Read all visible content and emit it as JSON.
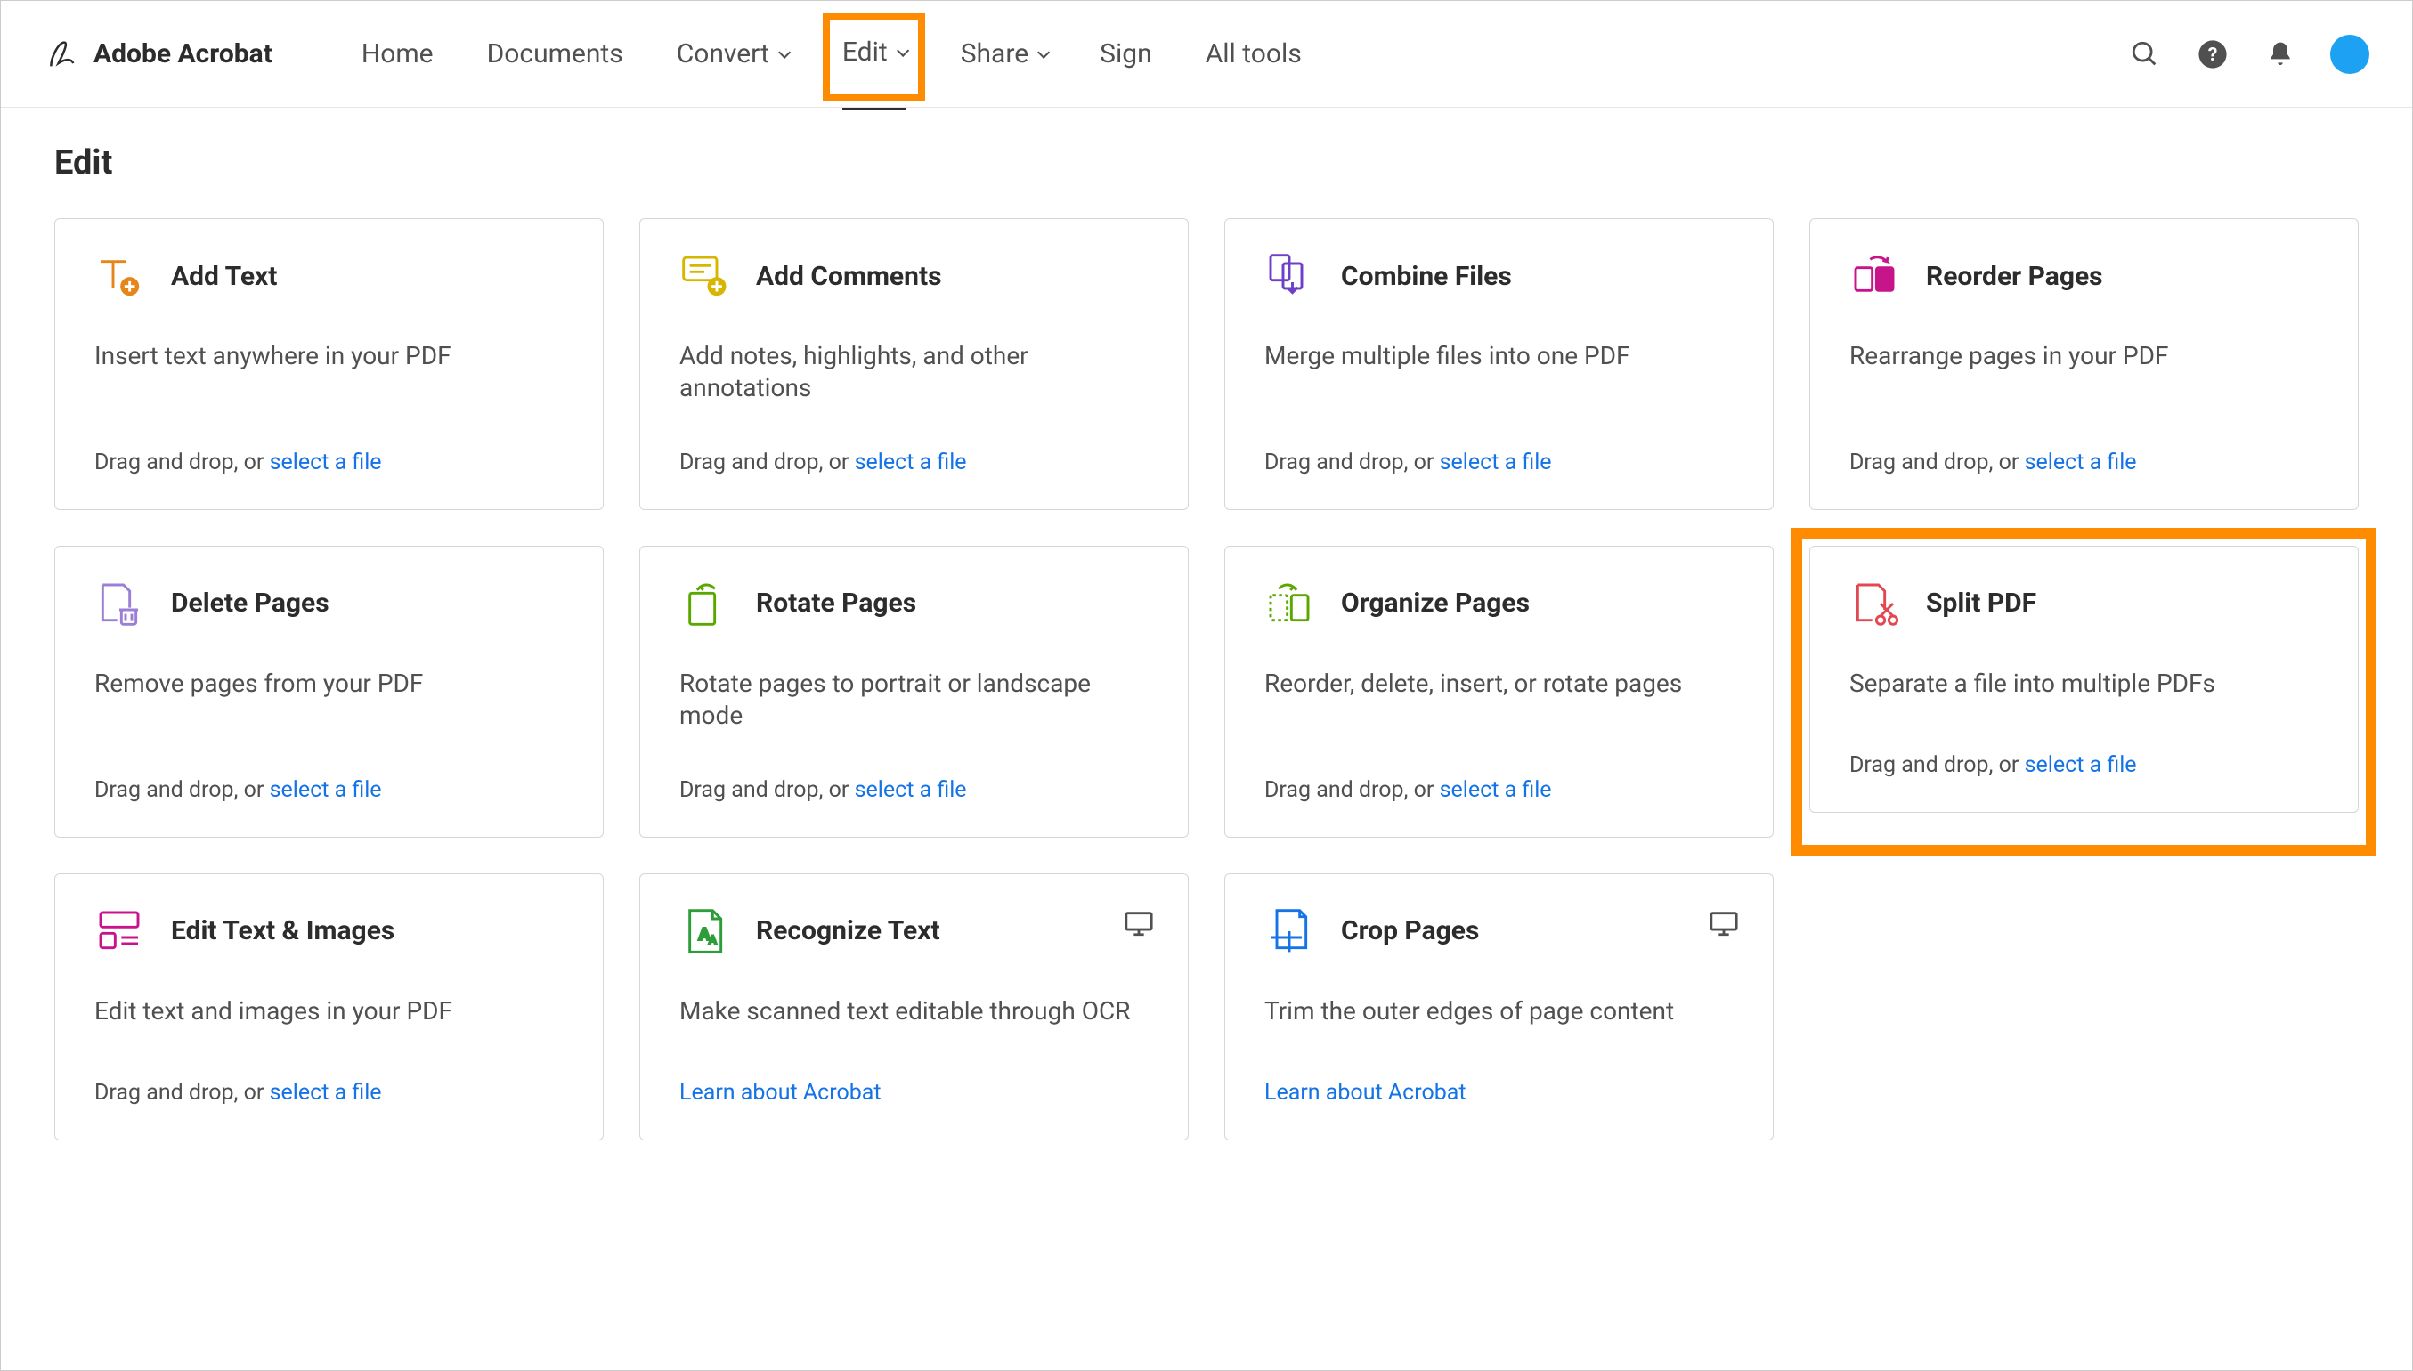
{
  "brand": "Adobe Acrobat",
  "nav": {
    "home": "Home",
    "documents": "Documents",
    "convert": "Convert",
    "edit": "Edit",
    "share": "Share",
    "sign": "Sign",
    "alltools": "All tools"
  },
  "page_title": "Edit",
  "cards": {
    "add_text": {
      "title": "Add Text",
      "desc": "Insert text anywhere in your PDF",
      "drag": "Drag and drop, or ",
      "link": "select a file"
    },
    "add_comments": {
      "title": "Add Comments",
      "desc": "Add notes, highlights, and other annotations",
      "drag": "Drag and drop, or ",
      "link": "select a file"
    },
    "combine": {
      "title": "Combine Files",
      "desc": "Merge multiple files into one PDF",
      "drag": "Drag and drop, or ",
      "link": "select a file"
    },
    "reorder": {
      "title": "Reorder Pages",
      "desc": "Rearrange pages in your PDF",
      "drag": "Drag and drop, or ",
      "link": "select a file"
    },
    "delete": {
      "title": "Delete Pages",
      "desc": "Remove pages from your PDF",
      "drag": "Drag and drop, or ",
      "link": "select a file"
    },
    "rotate": {
      "title": "Rotate Pages",
      "desc": "Rotate pages to portrait or landscape mode",
      "drag": "Drag and drop, or ",
      "link": "select a file"
    },
    "organize": {
      "title": "Organize Pages",
      "desc": "Reorder, delete, insert, or rotate pages",
      "drag": "Drag and drop, or ",
      "link": "select a file"
    },
    "split": {
      "title": "Split PDF",
      "desc": "Separate a file into multiple PDFs",
      "drag": "Drag and drop, or ",
      "link": "select a file"
    },
    "edit_ti": {
      "title": "Edit Text & Images",
      "desc": "Edit text and images in your PDF",
      "drag": "Drag and drop, or ",
      "link": "select a file"
    },
    "recognize": {
      "title": "Recognize Text",
      "desc": "Make scanned text editable through OCR",
      "learn": "Learn about Acrobat"
    },
    "crop": {
      "title": "Crop Pages",
      "desc": "Trim the outer edges of page content",
      "learn": "Learn about Acrobat"
    }
  }
}
